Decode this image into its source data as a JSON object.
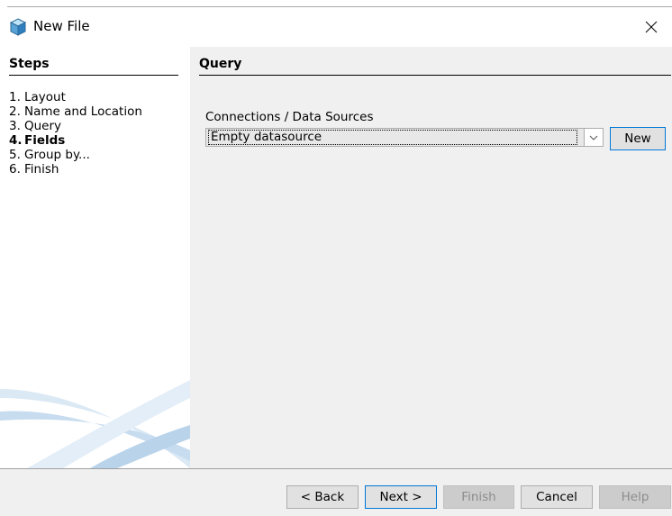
{
  "window": {
    "title": "New File"
  },
  "steps": {
    "title": "Steps",
    "items": [
      {
        "num": "1.",
        "label": "Layout"
      },
      {
        "num": "2.",
        "label": "Name and Location"
      },
      {
        "num": "3.",
        "label": "Query"
      },
      {
        "num": "4.",
        "label": "Fields",
        "current": true
      },
      {
        "num": "5.",
        "label": "Group by..."
      },
      {
        "num": "6.",
        "label": "Finish"
      }
    ]
  },
  "main": {
    "title": "Query",
    "connections_label": "Connections / Data Sources",
    "datasource_value": "Empty datasource",
    "new_label": "New"
  },
  "footer": {
    "back_label": "< Back",
    "next_label": "Next >",
    "finish_label": "Finish",
    "cancel_label": "Cancel",
    "help_label": "Help"
  },
  "colors": {
    "accent_border": "#0078d7",
    "content_bg": "#f0f0f0",
    "disabled_text": "#8c8c8c"
  },
  "icons": {
    "app": "netbeans-cube-icon",
    "close": "close-icon",
    "dropdown": "chevron-down-icon"
  }
}
